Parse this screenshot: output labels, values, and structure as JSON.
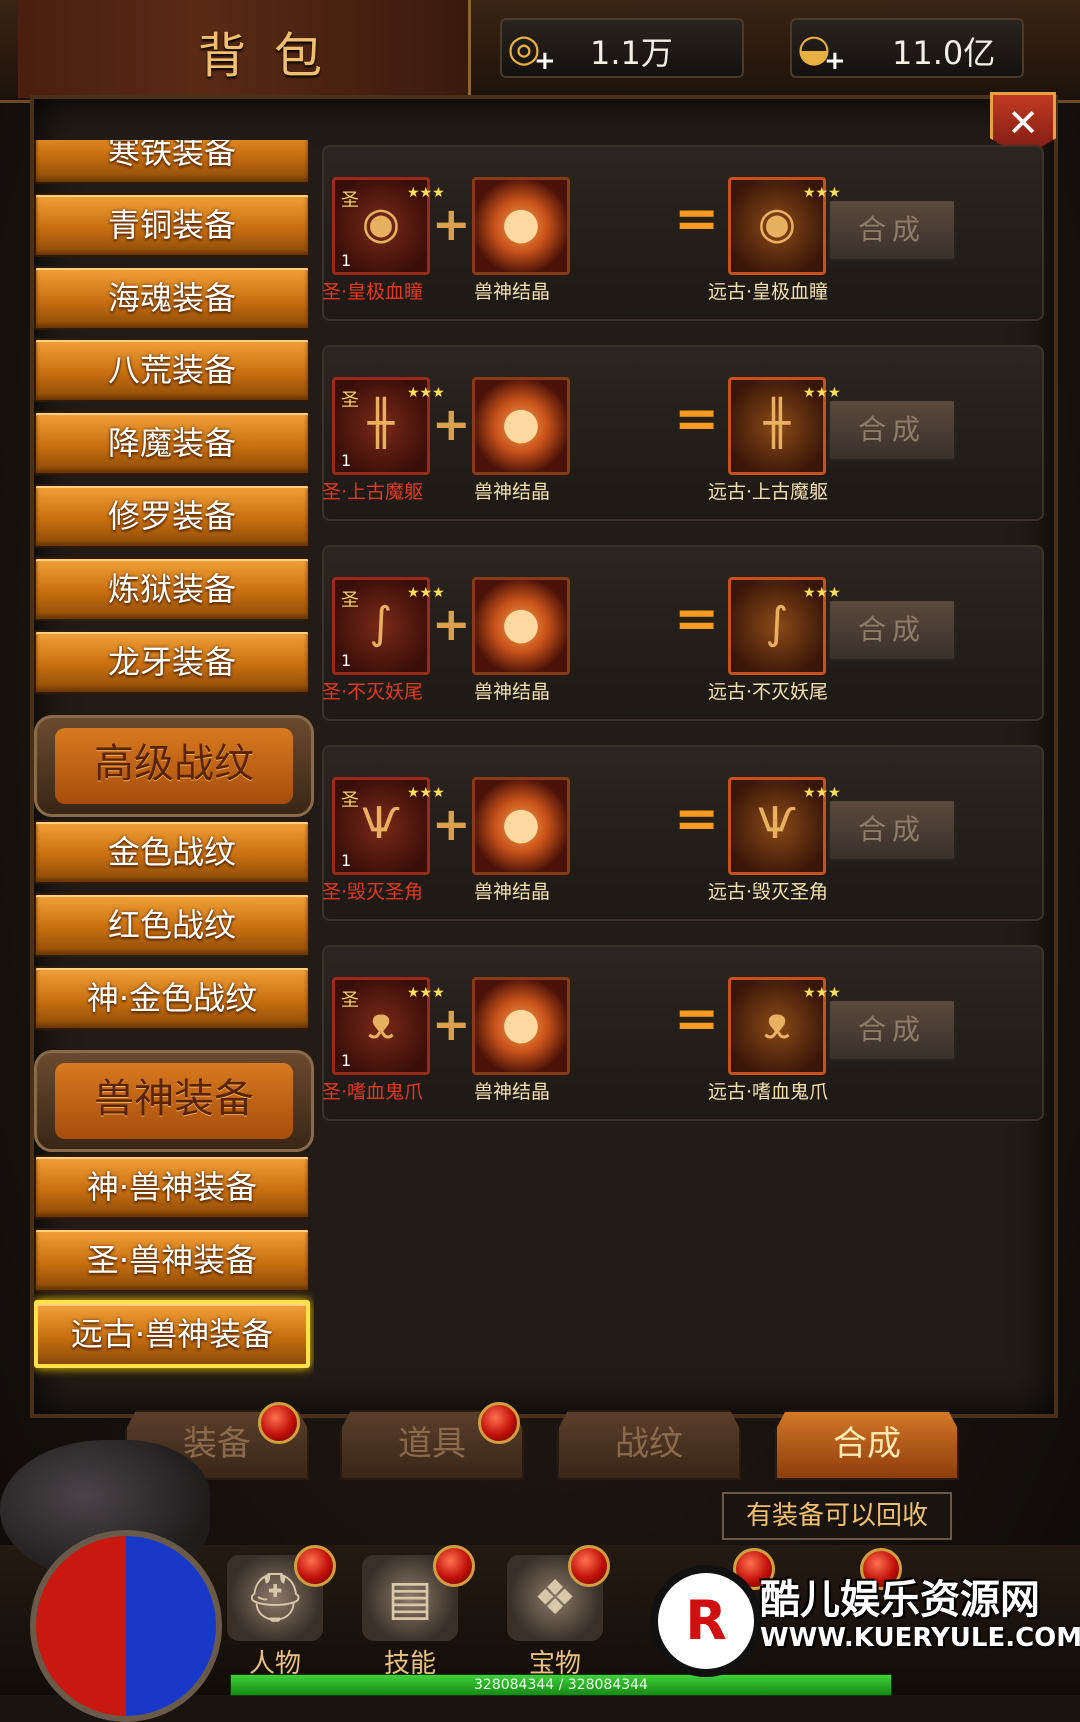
{
  "header": {
    "title": "背包",
    "copper": "1.1万",
    "ingot": "11.0亿"
  },
  "sidebar": {
    "items": [
      {
        "label": "寒铁装备",
        "type": "button"
      },
      {
        "label": "青铜装备",
        "type": "button"
      },
      {
        "label": "海魂装备",
        "type": "button"
      },
      {
        "label": "八荒装备",
        "type": "button"
      },
      {
        "label": "降魔装备",
        "type": "button"
      },
      {
        "label": "修罗装备",
        "type": "button"
      },
      {
        "label": "炼狱装备",
        "type": "button"
      },
      {
        "label": "龙牙装备",
        "type": "button"
      },
      {
        "label": "高级战纹",
        "type": "header"
      },
      {
        "label": "金色战纹",
        "type": "button"
      },
      {
        "label": "红色战纹",
        "type": "button"
      },
      {
        "label": "神·金色战纹",
        "type": "button"
      },
      {
        "label": "兽神装备",
        "type": "header"
      },
      {
        "label": "神·兽神装备",
        "type": "button"
      },
      {
        "label": "圣·兽神装备",
        "type": "button"
      },
      {
        "label": "远古·兽神装备",
        "type": "button",
        "selected": true
      }
    ]
  },
  "recipes": [
    {
      "input": "圣·皇极血瞳",
      "input_tag": "圣",
      "input_count": "1",
      "material": "兽神结晶",
      "output": "远古·皇极血瞳",
      "button": "合成"
    },
    {
      "input": "圣·上古魔躯",
      "input_tag": "圣",
      "input_count": "1",
      "material": "兽神结晶",
      "output": "远古·上古魔躯",
      "button": "合成"
    },
    {
      "input": "圣·不灭妖尾",
      "input_tag": "圣",
      "input_count": "1",
      "material": "兽神结晶",
      "output": "远古·不灭妖尾",
      "button": "合成"
    },
    {
      "input": "圣·毁灭圣角",
      "input_tag": "圣",
      "input_count": "1",
      "material": "兽神结晶",
      "output": "远古·毁灭圣角",
      "button": "合成"
    },
    {
      "input": "圣·嗜血鬼爪",
      "input_tag": "圣",
      "input_count": "1",
      "material": "兽神结晶",
      "output": "远古·嗜血鬼爪",
      "button": "合成"
    }
  ],
  "tabs": [
    {
      "label": "装备",
      "badge": true
    },
    {
      "label": "道具",
      "badge": true
    },
    {
      "label": "战纹",
      "badge": false
    },
    {
      "label": "合成",
      "badge": false,
      "active": true
    }
  ],
  "notice": "有装备可以回收",
  "bottom_menu": [
    {
      "label": "人物",
      "icon": "helmet-icon"
    },
    {
      "label": "技能",
      "icon": "skill-book-icon"
    },
    {
      "label": "宝物",
      "icon": "treasure-icon"
    }
  ],
  "hp": "328084344 / 328084344",
  "watermark": {
    "title": "酷儿娱乐资源网",
    "url": "WWW.KUERYULE.COM",
    "logo_letter": "R"
  },
  "colors": {
    "accent": "#f1a23a",
    "selected_border": "#ffe24a",
    "input_name": "#e03a22",
    "output_name": "#f0e0b0",
    "equals": "#ff9a20"
  }
}
